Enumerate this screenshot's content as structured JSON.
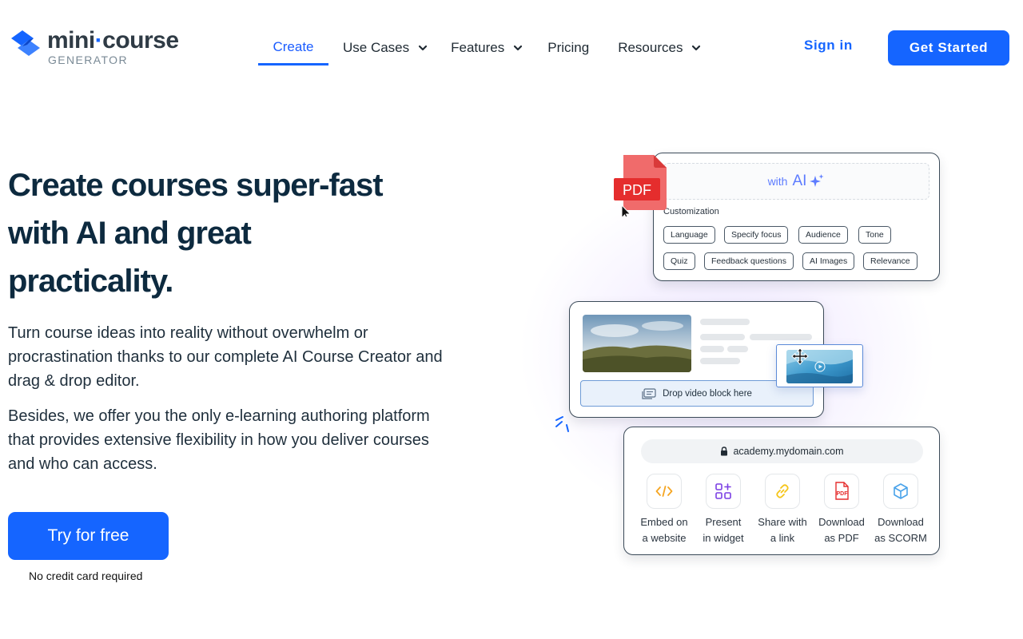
{
  "brand": {
    "name_left": "mini",
    "name_dot": "·",
    "name_right": "course",
    "subtitle": "GENERATOR",
    "color": "#1565ff"
  },
  "nav": {
    "create": "Create",
    "use_cases": "Use Cases",
    "features": "Features",
    "pricing": "Pricing",
    "resources": "Resources",
    "active": "Create"
  },
  "header": {
    "signin": "Sign in",
    "get_started": "Get Started"
  },
  "hero": {
    "title": "Create courses super-fast with AI and great practicality.",
    "paragraph1": "Turn course ideas into reality without overwhelm or procrastination thanks to our complete AI Course Creator and drag & drop editor.",
    "paragraph2": "Besides, we offer you the only e-learning authoring platform that provides extensive flexibility in how you deliver courses and who can access.",
    "cta": "Try for free",
    "note": "No credit card required"
  },
  "ai_card": {
    "pdf_label": "PDF",
    "with": "with",
    "ai": "AI",
    "customization_label": "Customization",
    "chips": [
      "Language",
      "Specify focus",
      "Audience",
      "Tone",
      "Quiz",
      "Feedback questions",
      "AI Images",
      "Relevance"
    ]
  },
  "editor_card": {
    "drop_label": "Drop video block here"
  },
  "share_card": {
    "url": "academy.mydomain.com",
    "options": [
      {
        "line1": "Embed on",
        "line2": "a website",
        "icon": "code-icon"
      },
      {
        "line1": "Present",
        "line2": "in widget",
        "icon": "widget-icon"
      },
      {
        "line1": "Share with",
        "line2": "a link",
        "icon": "link-icon"
      },
      {
        "line1": "Download",
        "line2": "as PDF",
        "icon": "pdf-icon",
        "icon_text": "PDF"
      },
      {
        "line1": "Download",
        "line2": "as SCORM",
        "icon": "cube-icon"
      }
    ]
  }
}
